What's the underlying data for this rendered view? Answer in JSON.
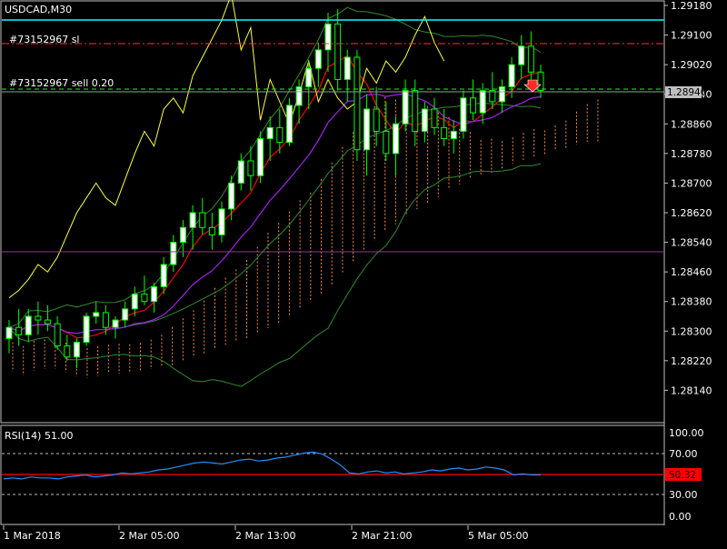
{
  "window_title": "USDCAD,M30",
  "trade_lines": {
    "sl_label": "#73152967 sl",
    "sell_label": "#73152967 sell 0.20",
    "sl_price": 1.2907,
    "entry_price": 1.28955
  },
  "current_price": "1.28946",
  "price_axis": {
    "min": 1.2806,
    "max": 1.2918,
    "ticks": [
      "1.29180",
      "1.29100",
      "1.29020",
      "1.28940",
      "1.28860",
      "1.28780",
      "1.28700",
      "1.28620",
      "1.28540",
      "1.28460",
      "1.28380",
      "1.28300",
      "1.28220",
      "1.28140"
    ]
  },
  "time_axis": {
    "ticks": [
      "1 Mar 2018",
      "2 Mar 05:00",
      "2 Mar 13:00",
      "2 Mar 21:00",
      "5 Mar 05:00"
    ]
  },
  "rsi": {
    "label": "RSI(14) 51.00",
    "current_value": "50.32",
    "levels": [
      "100.00",
      "70.00",
      "50.00",
      "30.00",
      "0.00"
    ]
  },
  "colors": {
    "background": "#000000",
    "bull_candle": "#ffffff",
    "bear_candle": "#000000",
    "candle_wick": "#00ff00",
    "bollinger": "#2e8b2e",
    "yellow_line": "#ffff33",
    "red_ma": "#ff0000",
    "purple_ma": "#a020f0",
    "cloud": "#ff8c42",
    "top_line": "#00ffff",
    "rsi_line": "#1e90ff",
    "rsi_level": "#ff0000",
    "sl_line": "#ff3333",
    "entry_line": "#00ff00"
  },
  "chart_data": {
    "type": "candlestick",
    "symbol": "USDCAD",
    "timeframe": "M30",
    "ylim": [
      1.2806,
      1.2918
    ],
    "candles_ohlc": [
      [
        1.2828,
        1.2833,
        1.2824,
        1.2831
      ],
      [
        1.2831,
        1.2836,
        1.2826,
        1.2829
      ],
      [
        1.2829,
        1.2836,
        1.2827,
        1.2834
      ],
      [
        1.2834,
        1.2838,
        1.2829,
        1.2833
      ],
      [
        1.2833,
        1.2837,
        1.283,
        1.2832
      ],
      [
        1.2832,
        1.2834,
        1.2825,
        1.2826
      ],
      [
        1.2826,
        1.2829,
        1.2822,
        1.2823
      ],
      [
        1.2823,
        1.2828,
        1.282,
        1.2827
      ],
      [
        1.2827,
        1.2835,
        1.2826,
        1.2834
      ],
      [
        1.2834,
        1.2838,
        1.2832,
        1.2835
      ],
      [
        1.2835,
        1.2837,
        1.2829,
        1.2831
      ],
      [
        1.2831,
        1.2834,
        1.2828,
        1.2833
      ],
      [
        1.2833,
        1.2838,
        1.2831,
        1.2836
      ],
      [
        1.2836,
        1.2842,
        1.2834,
        1.284
      ],
      [
        1.284,
        1.2845,
        1.2837,
        1.2838
      ],
      [
        1.2838,
        1.2843,
        1.2835,
        1.2842
      ],
      [
        1.2842,
        1.285,
        1.284,
        1.2848
      ],
      [
        1.2848,
        1.2856,
        1.2846,
        1.2854
      ],
      [
        1.2854,
        1.286,
        1.285,
        1.2858
      ],
      [
        1.2858,
        1.2864,
        1.2852,
        1.2862
      ],
      [
        1.2862,
        1.2866,
        1.2856,
        1.2858
      ],
      [
        1.2858,
        1.2862,
        1.2852,
        1.2856
      ],
      [
        1.2856,
        1.2865,
        1.2854,
        1.2863
      ],
      [
        1.2863,
        1.2872,
        1.286,
        1.287
      ],
      [
        1.287,
        1.2878,
        1.2868,
        1.2876
      ],
      [
        1.2876,
        1.288,
        1.2868,
        1.2872
      ],
      [
        1.2872,
        1.2884,
        1.287,
        1.2882
      ],
      [
        1.2882,
        1.2888,
        1.2876,
        1.2885
      ],
      [
        1.2885,
        1.289,
        1.2878,
        1.2881
      ],
      [
        1.2881,
        1.2893,
        1.288,
        1.2891
      ],
      [
        1.2891,
        1.2898,
        1.2886,
        1.2896
      ],
      [
        1.2896,
        1.2903,
        1.289,
        1.2901
      ],
      [
        1.2901,
        1.2908,
        1.2896,
        1.2906
      ],
      [
        1.2906,
        1.2916,
        1.29,
        1.2913
      ],
      [
        1.2913,
        1.2917,
        1.2895,
        1.2898
      ],
      [
        1.2898,
        1.2906,
        1.2892,
        1.2904
      ],
      [
        1.2904,
        1.2906,
        1.2876,
        1.2879
      ],
      [
        1.2879,
        1.2894,
        1.2872,
        1.289
      ],
      [
        1.289,
        1.2896,
        1.288,
        1.2884
      ],
      [
        1.2884,
        1.2892,
        1.2876,
        1.2878
      ],
      [
        1.2878,
        1.2888,
        1.2872,
        1.2886
      ],
      [
        1.2886,
        1.2898,
        1.2884,
        1.2895
      ],
      [
        1.2895,
        1.2898,
        1.288,
        1.2884
      ],
      [
        1.2884,
        1.2892,
        1.2881,
        1.289
      ],
      [
        1.289,
        1.2893,
        1.2883,
        1.2885
      ],
      [
        1.2885,
        1.289,
        1.288,
        1.2882
      ],
      [
        1.2882,
        1.2887,
        1.2878,
        1.2884
      ],
      [
        1.2884,
        1.2895,
        1.2882,
        1.2893
      ],
      [
        1.2893,
        1.2898,
        1.2887,
        1.2889
      ],
      [
        1.2889,
        1.2897,
        1.2886,
        1.2895
      ],
      [
        1.2895,
        1.29,
        1.289,
        1.2892
      ],
      [
        1.2892,
        1.2898,
        1.2889,
        1.2896
      ],
      [
        1.2896,
        1.2904,
        1.2893,
        1.2902
      ],
      [
        1.2902,
        1.291,
        1.2898,
        1.2907
      ],
      [
        1.2907,
        1.2911,
        1.2898,
        1.29
      ],
      [
        1.29,
        1.2902,
        1.2893,
        1.2895
      ]
    ],
    "rsi_values": [
      46,
      47,
      46,
      48,
      47,
      47,
      46,
      48,
      49,
      50,
      48,
      49,
      50,
      52,
      51,
      52,
      53,
      55,
      56,
      58,
      60,
      62,
      63,
      62,
      61,
      63,
      65,
      66,
      64,
      65,
      67,
      68,
      70,
      72,
      73,
      71,
      66,
      60,
      52,
      51,
      53,
      54,
      52,
      53,
      51,
      52,
      53,
      55,
      54,
      56,
      57,
      55,
      56,
      58,
      57,
      55,
      50,
      51,
      50,
      50
    ],
    "rsi_ylim": [
      0,
      100
    ]
  }
}
